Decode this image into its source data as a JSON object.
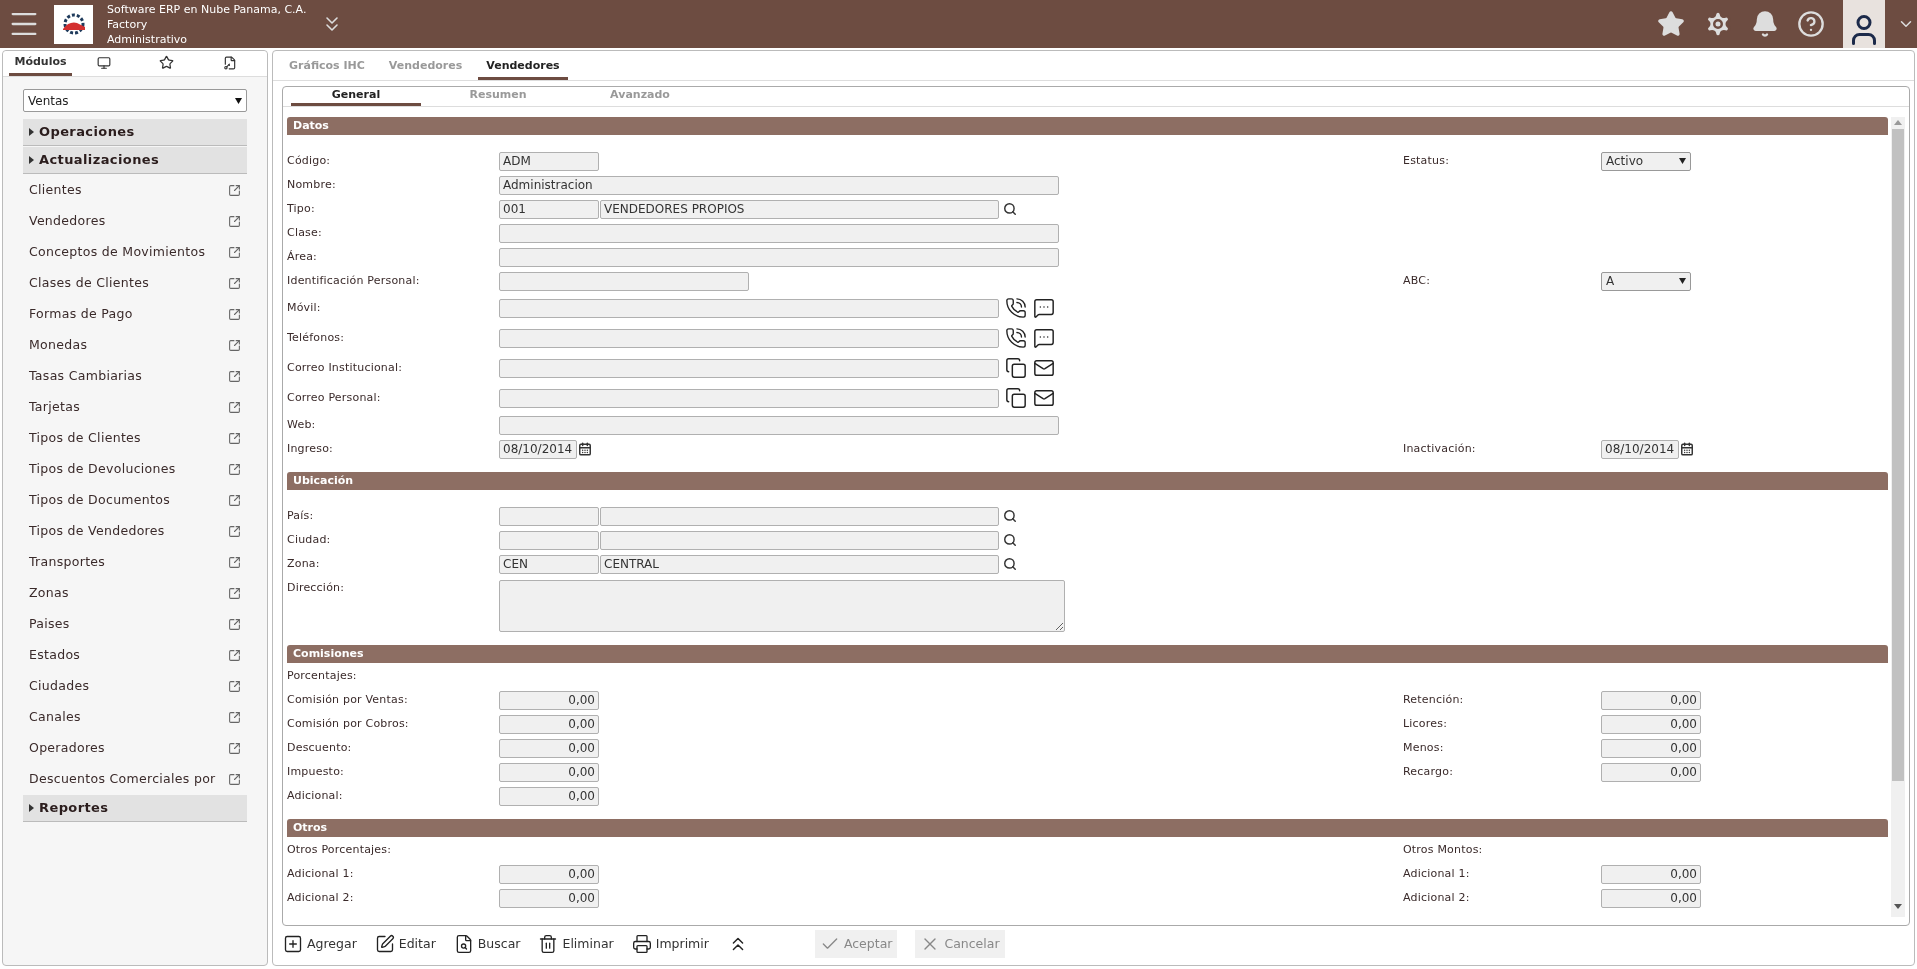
{
  "header": {
    "company": "Software ERP en Nube Panama, C.A.",
    "app": "Factory",
    "role": "Administrativo"
  },
  "sidebar": {
    "tabs": [
      {
        "kind": "text",
        "label": "Módulos",
        "selected": true
      },
      {
        "kind": "monitor",
        "selected": false
      },
      {
        "kind": "star",
        "selected": false
      },
      {
        "kind": "key",
        "selected": false
      }
    ],
    "module_select": "Ventas",
    "groups": [
      {
        "label": "Operaciones"
      },
      {
        "label": "Actualizaciones",
        "items": [
          "Clientes",
          "Vendedores",
          "Conceptos de Movimientos",
          "Clases de Clientes",
          "Formas de Pago",
          "Monedas",
          "Tasas Cambiarias",
          "Tarjetas",
          "Tipos de Clientes",
          "Tipos de Devoluciones",
          "Tipos de Documentos",
          "Tipos de Vendedores",
          "Transportes",
          "Zonas",
          "Paises",
          "Estados",
          "Ciudades",
          "Canales",
          "Operadores",
          "Descuentos Comerciales por"
        ]
      },
      {
        "label": "Reportes"
      }
    ]
  },
  "tabs": [
    {
      "label": "Gráficos IHC",
      "selected": false
    },
    {
      "label": "Vendedores",
      "selected": false
    },
    {
      "label": "Vendedores",
      "selected": true
    }
  ],
  "subtabs": [
    {
      "label": "General",
      "selected": true
    },
    {
      "label": "Resumen",
      "selected": false
    },
    {
      "label": "Avanzado",
      "selected": false
    }
  ],
  "sections": [
    {
      "title": "Datos",
      "rows": [
        {
          "left": {
            "kind": "code",
            "label": "Código:",
            "values": [
              "ADM"
            ]
          },
          "right": {
            "kind": "select",
            "label": "Estatus:",
            "value": "Activo"
          }
        },
        {
          "left": {
            "kind": "text",
            "label": "Nombre:",
            "values": [
              "Administracion"
            ]
          }
        },
        {
          "left": {
            "kind": "lookup",
            "label": "Tipo:",
            "values": [
              "001",
              "VENDEDORES PROPIOS"
            ]
          }
        },
        {
          "left": {
            "kind": "text",
            "label": "Clase:"
          }
        },
        {
          "left": {
            "kind": "text",
            "label": "Área:"
          }
        },
        {
          "left": {
            "kind": "id",
            "label": "Identificación Personal:"
          },
          "right": {
            "kind": "select",
            "label": "ABC:",
            "value": "A"
          }
        },
        {
          "left": {
            "kind": "phone",
            "label": "Móvil:"
          }
        },
        {
          "left": {
            "kind": "phone",
            "label": "Teléfonos:"
          }
        },
        {
          "left": {
            "kind": "email",
            "label": "Correo Institucional:"
          }
        },
        {
          "left": {
            "kind": "email",
            "label": "Correo Personal:"
          }
        },
        {
          "left": {
            "kind": "text",
            "label": "Web:"
          }
        },
        {
          "left": {
            "kind": "date",
            "label": "Ingreso:",
            "values": [
              "08/10/2014"
            ]
          },
          "right": {
            "kind": "date",
            "label": "Inactivación:",
            "values": [
              "08/10/2014"
            ]
          }
        }
      ]
    },
    {
      "title": "Ubicación",
      "rows": [
        {
          "left": {
            "kind": "lookup",
            "label": "País:"
          }
        },
        {
          "left": {
            "kind": "lookup",
            "label": "Ciudad:"
          }
        },
        {
          "left": {
            "kind": "lookup",
            "label": "Zona:",
            "values": [
              "CEN",
              "CENTRAL"
            ]
          }
        },
        {
          "left": {
            "kind": "textarea",
            "label": "Dirección:"
          }
        }
      ]
    },
    {
      "title": "Comisiones",
      "rows": [
        {
          "left": {
            "kind": "heading",
            "label": "Porcentajes:"
          }
        },
        {
          "left": {
            "kind": "number",
            "label": "Comisión por Ventas:",
            "values": [
              "0,00"
            ]
          },
          "right": {
            "kind": "number",
            "label": "Retención:",
            "values": [
              "0,00"
            ]
          }
        },
        {
          "left": {
            "kind": "number",
            "label": "Comisión por Cobros:",
            "values": [
              "0,00"
            ]
          },
          "right": {
            "kind": "number",
            "label": "Licores:",
            "values": [
              "0,00"
            ]
          }
        },
        {
          "left": {
            "kind": "number",
            "label": "Descuento:",
            "values": [
              "0,00"
            ]
          },
          "right": {
            "kind": "number",
            "label": "Menos:",
            "values": [
              "0,00"
            ]
          }
        },
        {
          "left": {
            "kind": "number",
            "label": "Impuesto:",
            "values": [
              "0,00"
            ]
          },
          "right": {
            "kind": "number",
            "label": "Recargo:",
            "values": [
              "0,00"
            ]
          }
        },
        {
          "left": {
            "kind": "number",
            "label": "Adicional:",
            "values": [
              "0,00"
            ]
          }
        }
      ]
    },
    {
      "title": "Otros",
      "rows": [
        {
          "left": {
            "kind": "heading",
            "label": "Otros Porcentajes:"
          },
          "right": {
            "kind": "heading",
            "label": "Otros Montos:"
          }
        },
        {
          "left": {
            "kind": "number",
            "label": "Adicional 1:",
            "values": [
              "0,00"
            ]
          },
          "right": {
            "kind": "number",
            "label": "Adicional 1:",
            "values": [
              "0,00"
            ]
          }
        },
        {
          "left": {
            "kind": "number",
            "label": "Adicional 2:",
            "values": [
              "0,00"
            ]
          },
          "right": {
            "kind": "number",
            "label": "Adicional 2:",
            "values": [
              "0,00"
            ]
          }
        }
      ]
    }
  ],
  "toolbar": [
    {
      "kind": "add",
      "label": "Agregar",
      "disabled": false
    },
    {
      "kind": "edit",
      "label": "Editar",
      "disabled": false
    },
    {
      "kind": "search",
      "label": "Buscar",
      "disabled": false
    },
    {
      "kind": "delete",
      "label": "Eliminar",
      "disabled": false
    },
    {
      "kind": "print",
      "label": "Imprimir",
      "disabled": false
    },
    {
      "kind": "collapse",
      "disabled": false
    },
    {
      "kind": "accept",
      "label": "Aceptar",
      "disabled": true
    },
    {
      "kind": "cancel",
      "label": "Cancelar",
      "disabled": true
    }
  ]
}
